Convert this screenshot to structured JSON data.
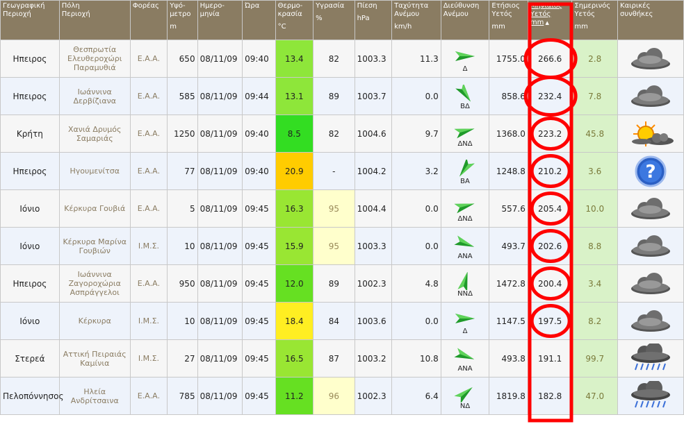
{
  "headers": [
    {
      "l1": "Γεωγραφική",
      "l2": "Περιοχή",
      "u": ""
    },
    {
      "l1": "Πόλη",
      "l2": "Περιοχή",
      "u": ""
    },
    {
      "l1": "Φορέας",
      "l2": "",
      "u": ""
    },
    {
      "l1": "Υψό-",
      "l2": "μετρο",
      "u": "m"
    },
    {
      "l1": "Ημερο-",
      "l2": "μηνία",
      "u": ""
    },
    {
      "l1": "Ώρα",
      "l2": "",
      "u": ""
    },
    {
      "l1": "Θερμο-",
      "l2": "κρασία",
      "u": "°C"
    },
    {
      "l1": "Υγρασία",
      "l2": "",
      "u": "%"
    },
    {
      "l1": "Πίεση",
      "l2": "",
      "u": "hPa"
    },
    {
      "l1": "Ταχύτητα",
      "l2": "Ανέμου",
      "u": "km/h"
    },
    {
      "l1": "Διεύθυνση",
      "l2": "Ανέμου",
      "u": ""
    },
    {
      "l1": "Ετήσιος",
      "l2": "Υετός",
      "u": "mm"
    },
    {
      "l1": "Μηνιαίος",
      "l2": "Υετός",
      "u": "mm"
    },
    {
      "l1": "Σημερινός",
      "l2": "Υετός",
      "u": "mm"
    },
    {
      "l1": "Καιρικές",
      "l2": "συνθήκες",
      "u": ""
    }
  ],
  "sort_indicator": "▲",
  "colors": {
    "header": "#8a7c62",
    "highlight_circle": "#ff0000"
  },
  "rows": [
    {
      "region": "Ηπειρος",
      "city": [
        "Θεσπρωτία",
        "Ελευθεροχώρι",
        "Παραμυθιά"
      ],
      "agency": "Ε.Α.Α.",
      "alt": "650",
      "date": "08/11/09",
      "time": "09:40",
      "temp": "13.4",
      "temp_color": "#8ee63a",
      "hum": "82",
      "hum_hl": false,
      "press": "1003.3",
      "wspeed": "11.3",
      "wdir": "Δ",
      "wdir_icon": "arrow-w",
      "annual": "1755.0",
      "monthly": "266.6",
      "today": "2.8",
      "weather_icon": "cloud-icon"
    },
    {
      "region": "Ηπειρος",
      "city": [
        "Ιωάννινα",
        "Δερβίζιανα"
      ],
      "agency": "Ε.Α.Α.",
      "alt": "585",
      "date": "08/11/09",
      "time": "09:44",
      "temp": "13.1",
      "temp_color": "#8ee63a",
      "hum": "89",
      "hum_hl": false,
      "press": "1003.7",
      "wspeed": "0.0",
      "wdir": "ΒΔ",
      "wdir_icon": "arrow-se",
      "annual": "858.6",
      "monthly": "232.4",
      "today": "7.8",
      "weather_icon": "cloud-icon"
    },
    {
      "region": "Κρήτη",
      "city": [
        "Χανιά Δρυμός",
        "Σαμαριάς"
      ],
      "agency": "Ε.Α.Α.",
      "alt": "1250",
      "date": "08/11/09",
      "time": "09:40",
      "temp": "8.5",
      "temp_color": "#33dd22",
      "hum": "82",
      "hum_hl": false,
      "press": "1004.6",
      "wspeed": "9.7",
      "wdir": "ΔΝΔ",
      "wdir_icon": "arrow-ene",
      "annual": "1368.0",
      "monthly": "223.2",
      "today": "45.8",
      "weather_icon": "sun-cloud-icon"
    },
    {
      "region": "Ηπειρος",
      "city": [
        "Ηγουμενίτσα"
      ],
      "agency": "Ε.Α.Α.",
      "alt": "77",
      "date": "08/11/09",
      "time": "09:40",
      "temp": "20.9",
      "temp_color": "#ffcc00",
      "hum": "-",
      "hum_hl": false,
      "press": "1004.2",
      "wspeed": "3.2",
      "wdir": "ΒΑ",
      "wdir_icon": "arrow-sw",
      "annual": "1248.8",
      "monthly": "210.2",
      "today": "3.6",
      "weather_icon": "help-icon"
    },
    {
      "region": "Ιόνιο",
      "city": [
        "Κέρκυρα Γουβιά"
      ],
      "agency": "Ε.Α.Α.",
      "alt": "5",
      "date": "08/11/09",
      "time": "09:45",
      "temp": "16.3",
      "temp_color": "#99e633",
      "hum": "95",
      "hum_hl": true,
      "press": "1004.4",
      "wspeed": "0.0",
      "wdir": "ΔΝΔ",
      "wdir_icon": "arrow-ene",
      "annual": "557.6",
      "monthly": "205.4",
      "today": "10.0",
      "weather_icon": "cloud-icon"
    },
    {
      "region": "Ιόνιο",
      "city": [
        "Κέρκυρα Μαρίνα",
        "Γουβιών"
      ],
      "agency": "Ι.Μ.Σ.",
      "alt": "10",
      "date": "08/11/09",
      "time": "09:45",
      "temp": "15.9",
      "temp_color": "#99e633",
      "hum": "95",
      "hum_hl": true,
      "press": "1003.3",
      "wspeed": "0.0",
      "wdir": "ΑΝΑ",
      "wdir_icon": "arrow-wsw",
      "annual": "493.7",
      "monthly": "202.6",
      "today": "8.8",
      "weather_icon": "cloud-icon"
    },
    {
      "region": "Ηπειρος",
      "city": [
        "Ιωάννινα",
        "Ζαγοροχώρια",
        "Ασπράγγελοι"
      ],
      "agency": "Ε.Α.Α.",
      "alt": "950",
      "date": "08/11/09",
      "time": "09:45",
      "temp": "12.0",
      "temp_color": "#66e022",
      "hum": "89",
      "hum_hl": false,
      "press": "1002.3",
      "wspeed": "4.8",
      "wdir": "ΝΝΔ",
      "wdir_icon": "arrow-nne",
      "annual": "1472.8",
      "monthly": "200.4",
      "today": "3.4",
      "weather_icon": "cloud-icon"
    },
    {
      "region": "Ιόνιο",
      "city": [
        "Κέρκυρα"
      ],
      "agency": "Ι.Μ.Σ.",
      "alt": "10",
      "date": "08/11/09",
      "time": "09:45",
      "temp": "18.4",
      "temp_color": "#ffee22",
      "hum": "84",
      "hum_hl": false,
      "press": "1003.6",
      "wspeed": "0.0",
      "wdir": "Δ",
      "wdir_icon": "arrow-e",
      "annual": "1147.5",
      "monthly": "197.5",
      "today": "8.2",
      "weather_icon": "cloud-icon"
    },
    {
      "region": "Στερεά",
      "city": [
        "Αττική Πειραιάς",
        "Καμίνια"
      ],
      "agency": "Ι.Μ.Σ.",
      "alt": "27",
      "date": "08/11/09",
      "time": "09:45",
      "temp": "16.5",
      "temp_color": "#99e633",
      "hum": "87",
      "hum_hl": false,
      "press": "1003.2",
      "wspeed": "10.8",
      "wdir": "ΑΝΑ",
      "wdir_icon": "arrow-wsw",
      "annual": "493.8",
      "monthly": "191.1",
      "today": "99.7",
      "weather_icon": "rain-icon"
    },
    {
      "region": "Πελοπόννησος",
      "city": [
        "Ηλεία",
        "Ανδρίτσαινα"
      ],
      "agency": "Ε.Α.Α.",
      "alt": "785",
      "date": "08/11/09",
      "time": "09:45",
      "temp": "11.2",
      "temp_color": "#66e022",
      "hum": "96",
      "hum_hl": true,
      "press": "1002.3",
      "wspeed": "6.4",
      "wdir": "ΝΔ",
      "wdir_icon": "arrow-ne",
      "annual": "1819.8",
      "monthly": "182.8",
      "today": "47.0",
      "weather_icon": "rain-icon"
    }
  ]
}
